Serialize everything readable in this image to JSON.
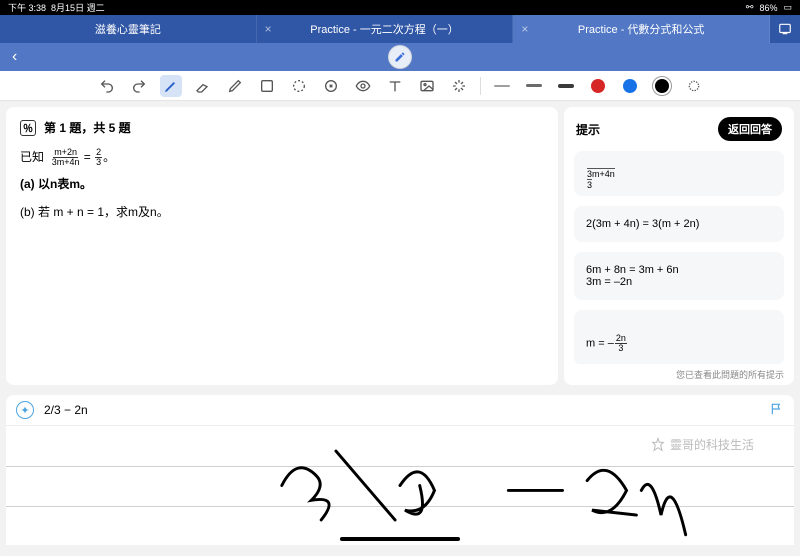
{
  "statusbar": {
    "time": "下午 3:38",
    "date": "8月15日 週二",
    "battery": "86%"
  },
  "tabs": [
    {
      "label": "滋養心靈筆記",
      "closable": false
    },
    {
      "label": "Practice - 一元二次方程（一）",
      "closable": true
    },
    {
      "label": "Practice - 代數分式和公式",
      "closable": true,
      "active": true
    }
  ],
  "toolbar": {
    "swatches": [
      {
        "kind": "line",
        "color": "#9e9e9e"
      },
      {
        "kind": "line",
        "color": "#6b6b6b"
      },
      {
        "kind": "line",
        "color": "#3a3a3a"
      },
      {
        "kind": "dot",
        "color": "#d62626"
      },
      {
        "kind": "dot",
        "color": "#1772e8"
      },
      {
        "kind": "dot",
        "color": "#000000",
        "ring": true
      },
      {
        "kind": "dotted",
        "color": "#666666"
      }
    ]
  },
  "question": {
    "header": "第 1 題，共 5 題",
    "given_label": "已知",
    "frac_top": "m+2n",
    "frac_bot": "3m+4n",
    "rhs_top": "2",
    "rhs_bot": "3",
    "partA": "(a) 以n表m。",
    "partB_pre": "(b) 若 m + n = 1，求m及n。"
  },
  "hints": {
    "title": "提示",
    "back_btn": "返回回答",
    "topline_left": "3m+4n",
    "topline_right": "3",
    "h1": "2(3m + 4n) = 3(m + 2n)",
    "h2": "6m + 8n = 3m + 6n\n3m = –2n",
    "h3_pre": "m = –",
    "h3_top": "2n",
    "h3_bot": "3",
    "footnote": "您已查看此問題的所有提示"
  },
  "answer": {
    "expr": "2/3 − 2n"
  },
  "watermark": "靈哥的科技生活"
}
